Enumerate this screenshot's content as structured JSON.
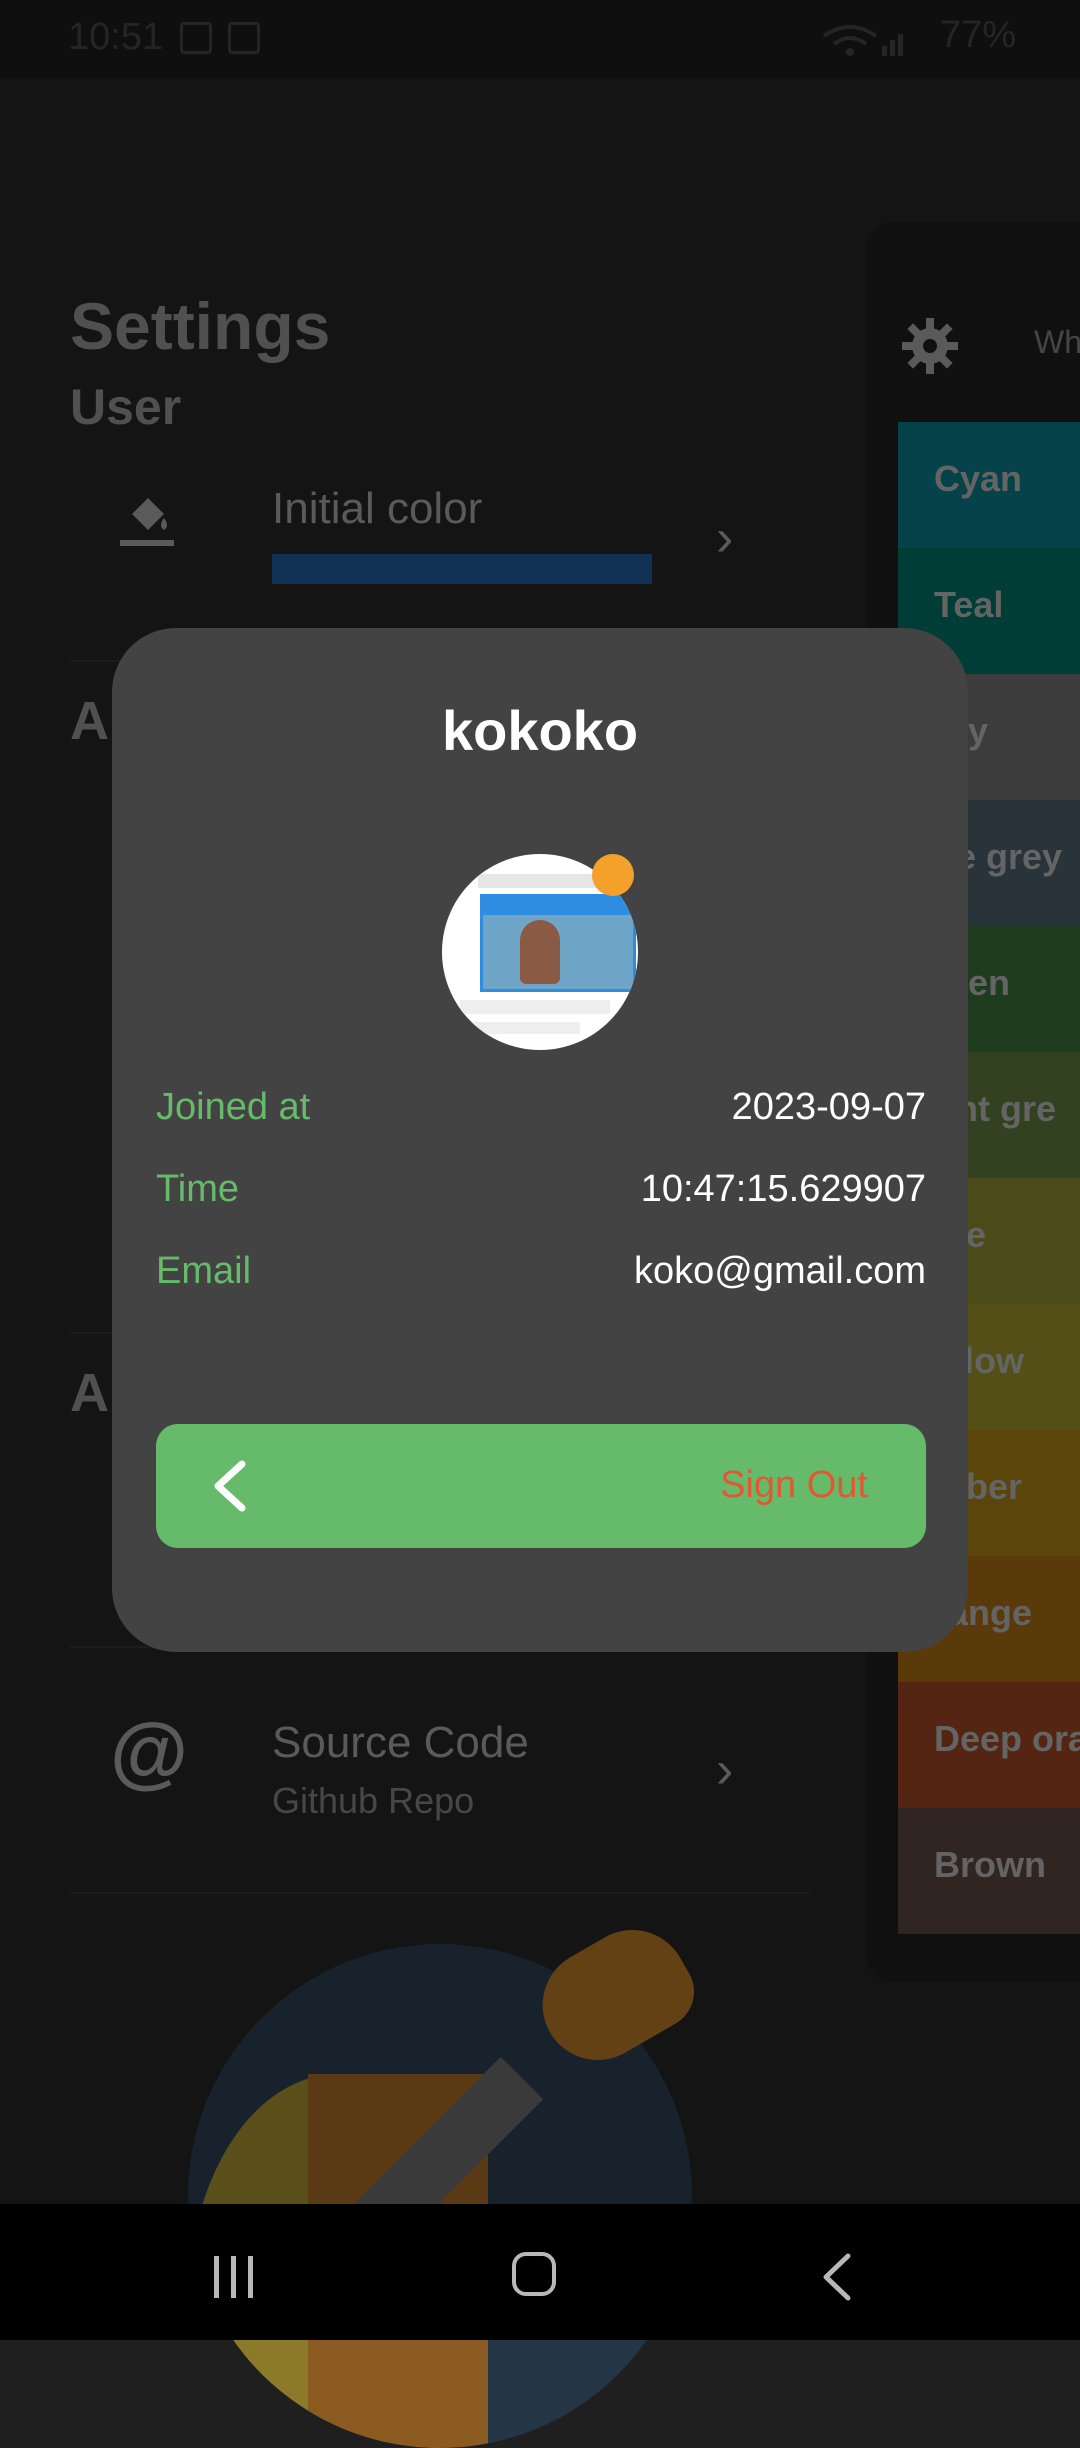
{
  "status_bar": {
    "time": "10:51",
    "battery": "77%"
  },
  "settings": {
    "title": "Settings",
    "user_section": "User",
    "initial_color": {
      "label": "Initial color",
      "color": "#1a4c80"
    },
    "section_a_fragment": "Ap",
    "section_b_fragment": "Al",
    "source_code": {
      "title": "Source Code",
      "subtitle": "Github Repo"
    }
  },
  "color_panel": {
    "header": "Wh",
    "swatches": [
      {
        "label": "Cyan",
        "color": "#0a6670"
      },
      {
        "label": "Teal",
        "color": "#015e54"
      },
      {
        "label": "rey",
        "color": "#5c5c5c"
      },
      {
        "label": "ue grey",
        "color": "#3e4f5a"
      },
      {
        "label": "reen",
        "color": "#2e5f30"
      },
      {
        "label": "ght gre",
        "color": "#4d6530"
      },
      {
        "label": "me",
        "color": "#727327"
      },
      {
        "label": "ellow",
        "color": "#827a22"
      },
      {
        "label": "mber",
        "color": "#8a6c10"
      },
      {
        "label": "range",
        "color": "#8a5a12"
      },
      {
        "label": "Deep ora",
        "color": "#823a1e"
      },
      {
        "label": "Brown",
        "color": "#4a3a34"
      }
    ]
  },
  "dialog": {
    "username": "kokoko",
    "rows": [
      {
        "label": "Joined at",
        "value": "2023-09-07"
      },
      {
        "label": "Time",
        "value": "10:47:15.629907"
      },
      {
        "label": "Email",
        "value": "koko@gmail.com"
      }
    ],
    "sign_out_label": "Sign Out"
  },
  "icons": {
    "bucket": "paint-bucket-icon",
    "at": "at-sign-icon",
    "gear": "gear-icon",
    "back": "back-arrow-icon"
  }
}
